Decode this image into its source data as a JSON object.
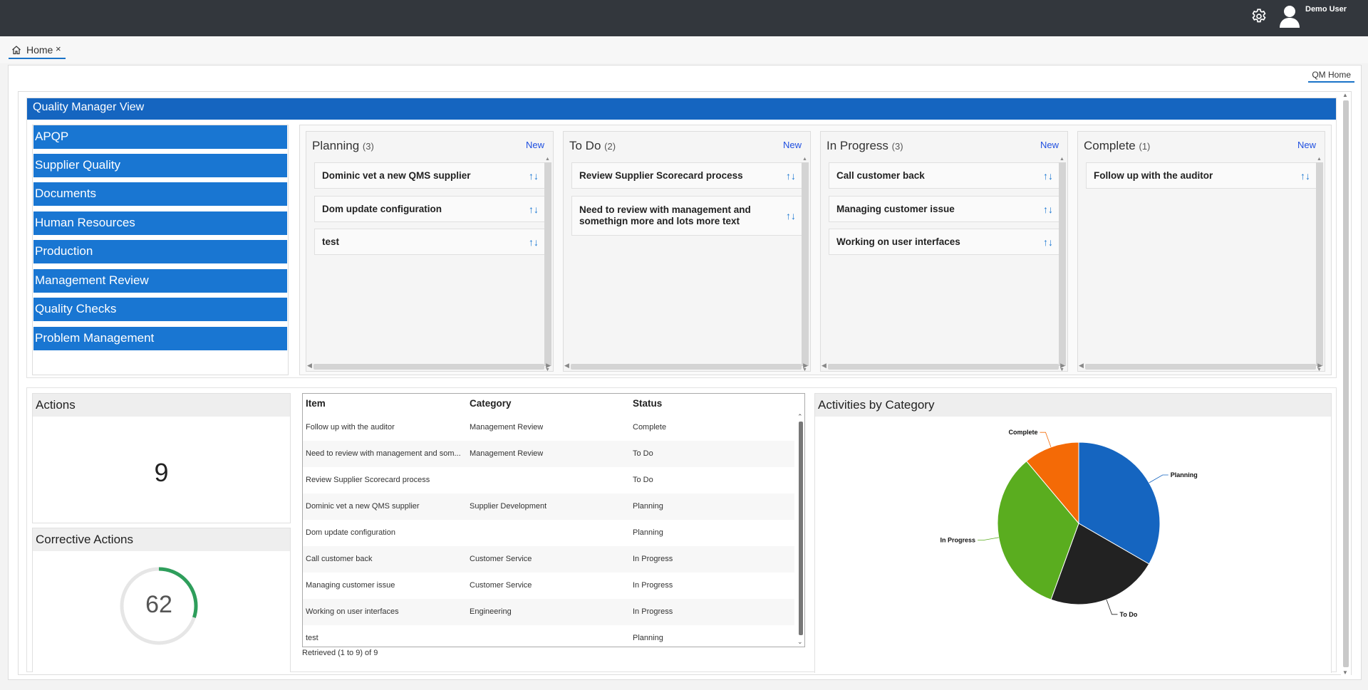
{
  "topbar": {
    "username": "Demo User"
  },
  "tabs": {
    "home_label": "Home",
    "home_close": "×"
  },
  "page_tab": "QM Home",
  "view_title": "Quality Manager View",
  "nav_items": [
    "APQP",
    "Supplier Quality",
    "Documents",
    "Human Resources",
    "Production",
    "Management Review",
    "Quality Checks",
    "Problem Management"
  ],
  "kanban": {
    "new_label": "New",
    "arrows": "↑↓",
    "columns": [
      {
        "title": "Planning",
        "count": "(3)",
        "cards": [
          "Dominic vet a new QMS supplier",
          "Dom update configuration",
          "test"
        ]
      },
      {
        "title": "To Do",
        "count": "(2)",
        "cards": [
          "Review Supplier Scorecard process",
          "Need to review with management and somethign more and lots more text"
        ]
      },
      {
        "title": "In Progress",
        "count": "(3)",
        "cards": [
          "Call customer back",
          "Managing customer issue",
          "Working on user interfaces"
        ]
      },
      {
        "title": "Complete",
        "count": "(1)",
        "cards": [
          "Follow up with the auditor"
        ]
      }
    ]
  },
  "actions": {
    "title": "Actions",
    "value": "9"
  },
  "corrective_actions": {
    "title": "Corrective Actions",
    "value": "62",
    "progress_fraction": 0.3
  },
  "grid": {
    "headers": [
      "Item",
      "Category",
      "Status"
    ],
    "rows": [
      [
        "Follow up with the auditor",
        "Management Review",
        "Complete"
      ],
      [
        "Need to review with management and som...",
        "Management Review",
        "To Do"
      ],
      [
        "Review Supplier Scorecard process",
        "",
        "To Do"
      ],
      [
        "Dominic vet a new QMS supplier",
        "Supplier Development",
        "Planning"
      ],
      [
        "Dom update configuration",
        "",
        "Planning"
      ],
      [
        "Call customer back",
        "Customer Service",
        "In Progress"
      ],
      [
        "Managing customer issue",
        "Customer Service",
        "In Progress"
      ],
      [
        "Working on user interfaces",
        "Engineering",
        "In Progress"
      ],
      [
        "test",
        "",
        "Planning"
      ]
    ],
    "retrieved": "Retrieved (1 to 9) of 9"
  },
  "chart_data": {
    "type": "pie",
    "title": "Activities by Category",
    "categories": [
      "Planning",
      "To Do",
      "In Progress",
      "Complete"
    ],
    "values": [
      3,
      2,
      3,
      1
    ],
    "colors": [
      "#1565c0",
      "#222222",
      "#5aad1f",
      "#f46a06"
    ]
  }
}
